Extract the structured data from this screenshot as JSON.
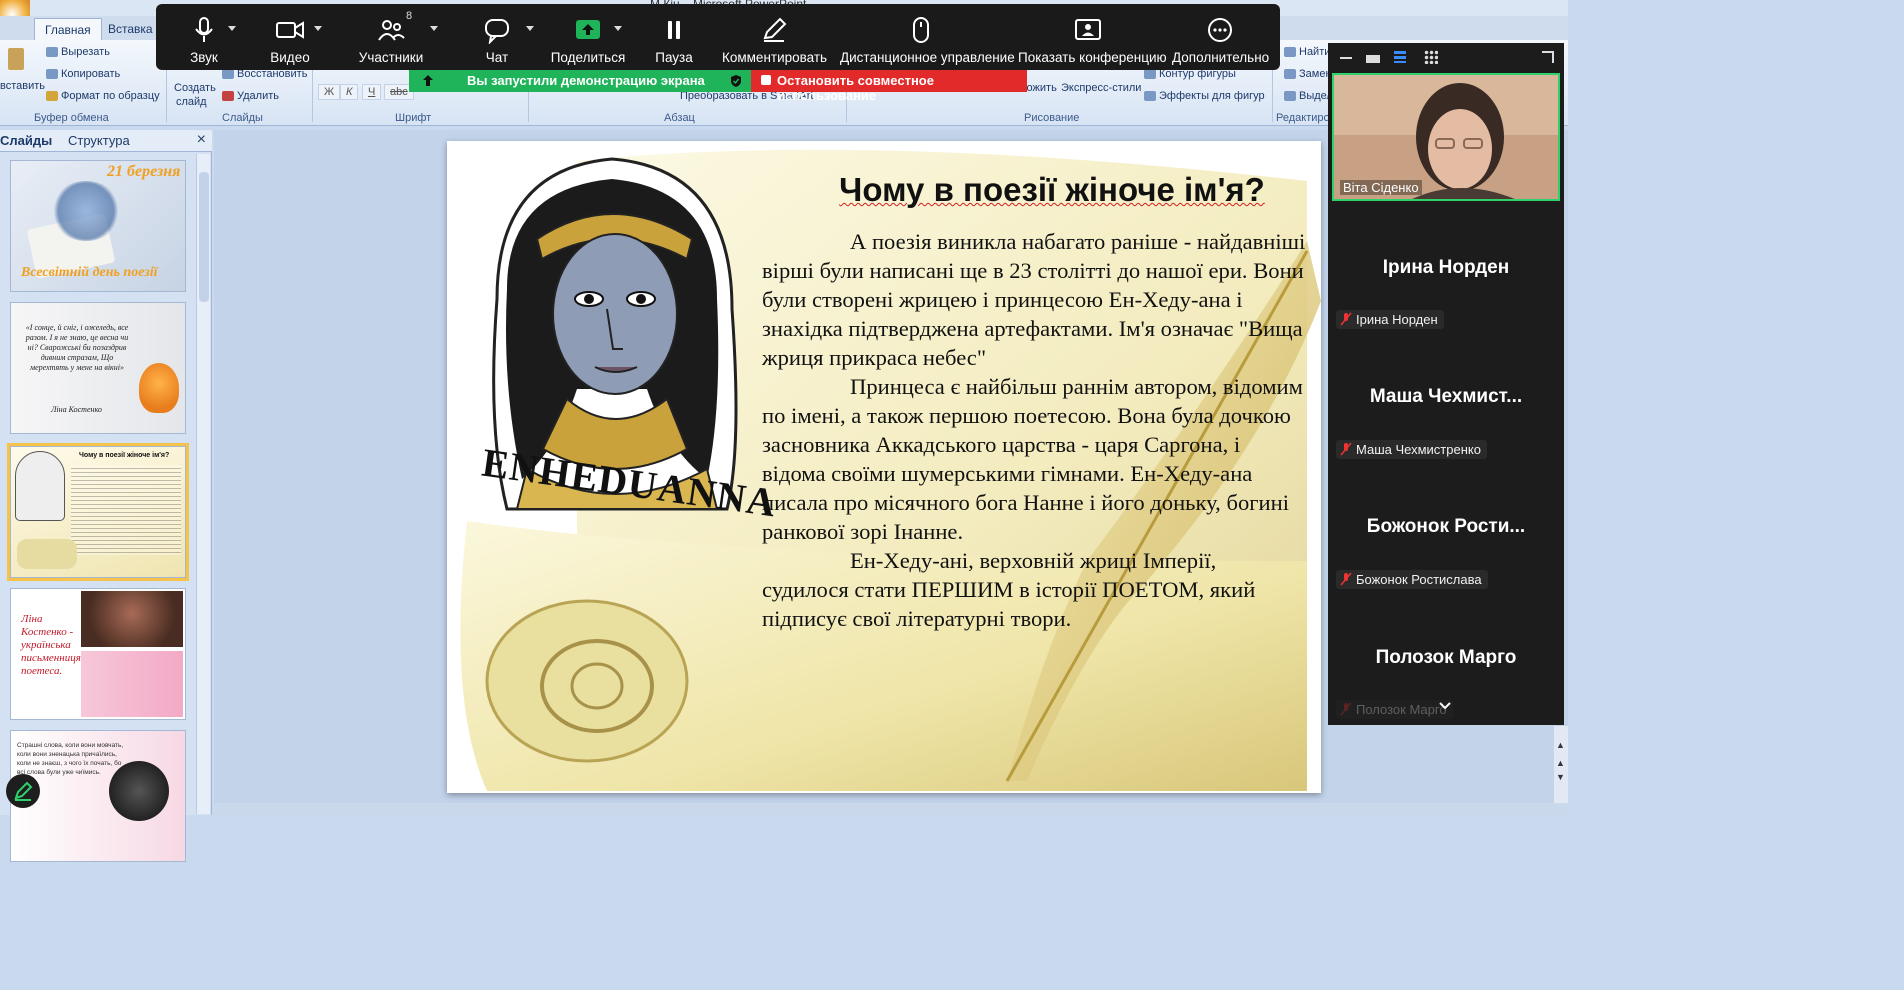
{
  "window": {
    "title": "М Кін... Microsoft PowerPoint"
  },
  "ribbon": {
    "tabs": [
      "Главная",
      "Вставка"
    ],
    "clipboard": {
      "paste": "вставить",
      "cut": "Вырезать",
      "copy": "Копировать",
      "format_painter": "Формат по образцу",
      "group": "Буфер обмена"
    },
    "slides": {
      "new_slide_1": "Создать",
      "new_slide_2": "слайд",
      "restore": "Восстановить",
      "delete": "Удалить",
      "group": "Слайды"
    },
    "font": {
      "group": "Шрифт"
    },
    "paragraph": {
      "group": "Абзац",
      "smartart": "Преобразовать в SmartArt"
    },
    "drawing": {
      "arrange": "ложить",
      "quick_styles": "Экспресс-стили",
      "shape_outline": "Контур фигуры",
      "shape_effects": "Эффекты для фигур",
      "group": "Рисование"
    },
    "editing": {
      "find": "Найти",
      "replace": "Замен",
      "select": "Выдел",
      "group": "Редактиро"
    }
  },
  "slide_pane": {
    "tabs": [
      "Слайды",
      "Структура"
    ],
    "close": "×",
    "thumbs": [
      {
        "title": "21 березня",
        "subtitle": "Всесвітній день поезії"
      },
      {
        "quote": "«І сонце, й сніг, і ожеледь, все разом. І я не знаю, це весна чи ні? Сварожські би позаздрив дивним стразам, Що мерехтять у мене на вікні»",
        "author": "Ліна Костенко"
      },
      {
        "title": "Чому в поезії жіноче ім'я?"
      },
      {
        "title": "Ліна Костенко - українська письменниця, поетеса."
      },
      {
        "text": "Страшні слова, коли вони мовчать, коли вони зненацька причаїлись, коли не знаєш, з чого їх почать, бо всі слова були уже чиїмись."
      }
    ]
  },
  "slide": {
    "title": "Чому в поезії жіноче ім'я?",
    "image_caption": "ENHEDUANNA",
    "paragraphs": [
      "А поезія виникла набагато раніше - найдавніші вірші були написані ще в 23 столітті до нашої ери. Вони були створені жрицею і принцесою Ен-Хеду-ана і знахідка підтверджена артефактами. Ім'я означає \"Вища жриця прикраса небес\"",
      "Принцеса є найбільш раннім автором, відомим по імені, а також першою поетесою. Вона була дочкою засновника Аккадського царства - царя Саргона, і відома своїми шумерськими гімнами. Ен-Хеду-ана писала про місячного бога Нанне і його доньку, богині ранкової зорі Інанне.",
      "Ен-Хеду-ані, верховній жриці Імперії, судилося стати ПЕРШИМ в історії ПОЕТОМ, який підписує свої літературні твори."
    ]
  },
  "zoom_toolbar": {
    "items": [
      {
        "label": "Звук",
        "icon": "microphone-icon"
      },
      {
        "label": "Видео",
        "icon": "video-camera-icon"
      },
      {
        "label": "Участники",
        "icon": "participants-icon",
        "count": "8"
      },
      {
        "label": "Чат",
        "icon": "chat-icon"
      },
      {
        "label": "Поделиться",
        "icon": "share-screen-icon"
      },
      {
        "label": "Пауза",
        "icon": "pause-icon"
      },
      {
        "label": "Комментировать",
        "icon": "pencil-icon"
      },
      {
        "label": "Дистанционное управление",
        "icon": "mouse-icon"
      },
      {
        "label": "Показать конференцию",
        "icon": "show-meeting-icon"
      },
      {
        "label": "Дополнительно",
        "icon": "more-icon"
      }
    ],
    "share_banner": "Вы запустили демонстрацию экрана",
    "stop_banner": "Остановить совместное использование",
    "colors": {
      "share_green": "#1fb35a",
      "stop_red": "#e22a2a",
      "toolbar_bg": "#1a1a1a"
    }
  },
  "participants": {
    "video_name": "Віта Сіденко",
    "list": [
      {
        "big": "Ірина Норден",
        "small": "Ірина Норден"
      },
      {
        "big": "Маша  Чехмист...",
        "small": "Маша Чехмистренко"
      },
      {
        "big": "Божонок  Рости...",
        "small": "Божонок Ростислава"
      },
      {
        "big": "Полозок Марго",
        "small": "Полозок Марго"
      }
    ]
  }
}
